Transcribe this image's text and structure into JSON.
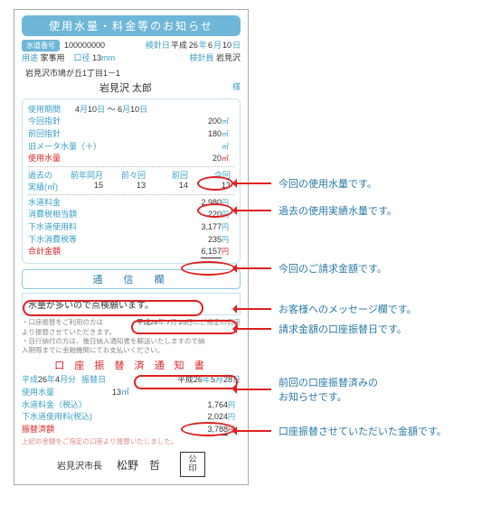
{
  "title": "使用水量・料金等のお知らせ",
  "header": {
    "suidouBangouLabel": "水道番号",
    "suidouBangou": "100000000",
    "kensinbiLabel": "検針日",
    "hei": "平成",
    "nen": "26",
    "nenU": "年",
    "tsuki": "6",
    "tsukiU": "月",
    "hi": "10",
    "hiU": "日",
    "youtoLabel": "用途",
    "youto": "家事用",
    "koukeiLabel": "口径",
    "koukei": "13",
    "koukeiU": "mm",
    "kensinInLabel": "検針員",
    "kensinIn": "岩見沢",
    "address": "岩見沢市鳩が丘1丁目1－1",
    "name": "岩見沢 太郎",
    "sama": "様"
  },
  "usage": {
    "periodLabel": "使用期間",
    "from": {
      "m": "4",
      "mU": "月",
      "d": "10",
      "dU": "日"
    },
    "sep": "～",
    "to": {
      "m": "6",
      "mU": "月",
      "d": "10",
      "dU": "日"
    },
    "konkaiLabel": "今回指針",
    "konkai": "200",
    "zenkaiLabel": "前回指針",
    "zenkai": "180",
    "kyuLabel": "旧メータ水量（＋）",
    "kyu": "",
    "shiyouLabel": "使用水量",
    "shiyou": "20",
    "unitM3": "㎥"
  },
  "history": {
    "header": "過去の",
    "cols": [
      "前年同月",
      "前々回",
      "前回",
      "今回"
    ],
    "jissekiLabel": "実績(㎥)",
    "vals": [
      "15",
      "13",
      "14",
      "13"
    ]
  },
  "charges": {
    "suiLabel": "水道料金",
    "sui": "2,980",
    "shouLabel": "消費税相当額",
    "shou": "220",
    "gesuiLabel": "下水道使用料",
    "gesui": "3,177",
    "shou2Label": "下水消費税等",
    "shou2": "235",
    "totalLabel": "合計金額",
    "total": "6,157",
    "yen": "円"
  },
  "comm": {
    "band": "通　信　欄",
    "message": "水量が多いので点検願います。",
    "note1": "・口座振替をご利用の方は",
    "dateHei": "平成",
    "dateY": "26",
    "dateYU": "年",
    "dateM": "7",
    "dateMU": "月",
    "dateD": "25",
    "dateDU": "日",
    "note1b": "にご指定の口座",
    "note1c": "より振替させていただきます。",
    "note2": "・自行納付の方は、後日納入通知書を郵送いたしますので納",
    "note2b": "入期限までに金融機関にてお支払いください。"
  },
  "transfer": {
    "title": "口 座 振 替 済 通 知 書",
    "hei1": "平成",
    "y1": "26",
    "yU": "年",
    "m1": "4",
    "bun": "月分",
    "furikaebiLabel": "振替日",
    "hei2": "平成",
    "y2": "26",
    "m2": "5",
    "d2": "28",
    "dU": "日",
    "shiyouLabel": "使用水量",
    "shiyou": "13",
    "unit": "㎥",
    "suiLabel": "水道料金（税込）",
    "sui": "1,764",
    "gesuiLabel": "下水道使用料(税込)",
    "gesui": "2,024",
    "totalLabel": "振替済額",
    "total": "3,788",
    "yen": "円",
    "footer": "上記の金額をご指定の口座より振替いたしました。"
  },
  "sign": {
    "mayor": "岩見沢市長",
    "name": "松野　哲",
    "seal": "公\n印"
  },
  "anno": {
    "a1": "今回の使用水量です。",
    "a2": "過去の使用実績水量です。",
    "a3": "今回のご請求金額です。",
    "a4": "お客様へのメッセージ欄です。",
    "a5": "請求金額の口座振替日です。",
    "a6a": "前回の口座振替済みの",
    "a6b": "お知らせです。",
    "a7": "口座振替させていただいた金額です。"
  }
}
